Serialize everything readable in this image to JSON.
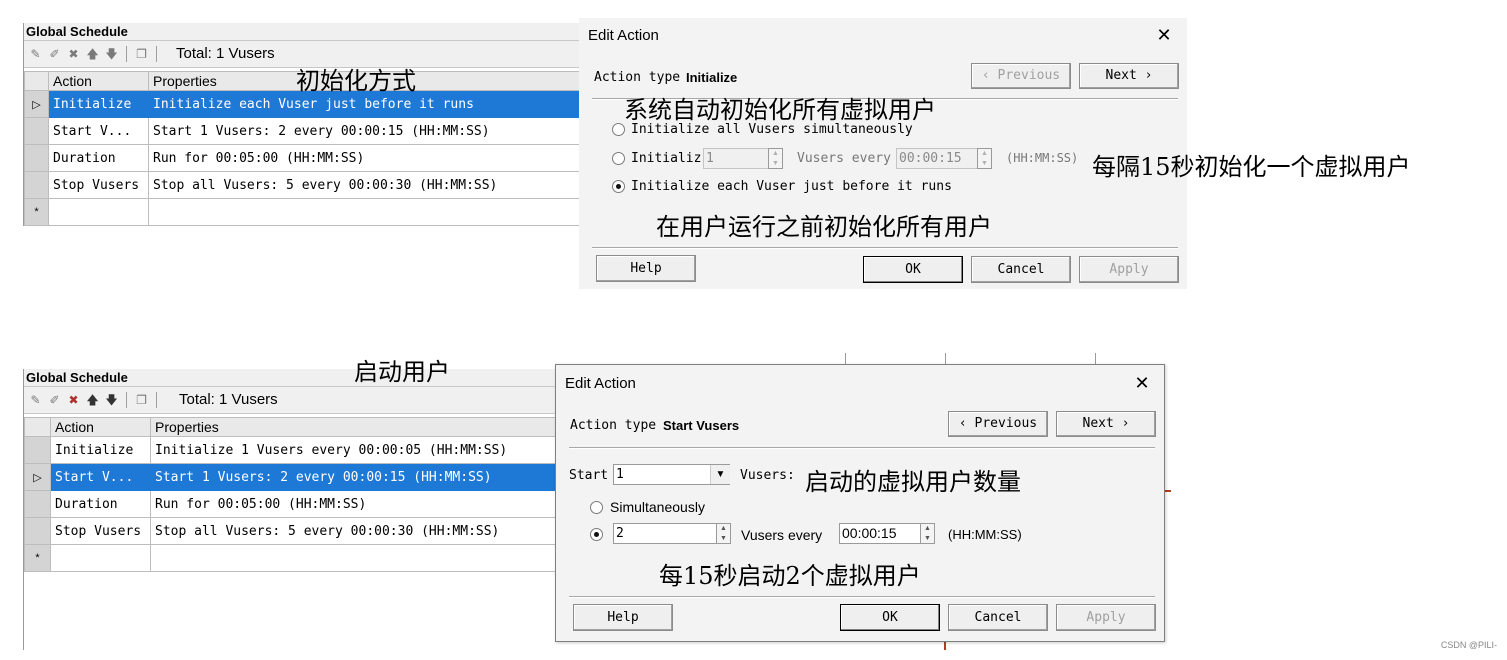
{
  "top": {
    "schedule": {
      "title": "Global Schedule",
      "total": "Total: 1 Vusers",
      "headers": [
        "Action",
        "Properties"
      ],
      "rows": [
        {
          "action": "Initialize",
          "properties": "Initialize each Vuser just before it runs"
        },
        {
          "action": "Start  V...",
          "properties": "Start 1 Vusers: 2 every 00:00:15 (HH:MM:SS)"
        },
        {
          "action": "Duration",
          "properties": "Run for 00:05:00 (HH:MM:SS)"
        },
        {
          "action": "Stop Vusers",
          "properties": "Stop all Vusers: 5 every 00:00:30 (HH:MM:SS)"
        }
      ]
    },
    "dialog": {
      "title": "Edit Action",
      "close": "✕",
      "action_type_label": "Action type",
      "action_type_value": "Initialize",
      "previous": "‹  Previous",
      "next": "Next  ›",
      "opt1": "Initialize all Vusers simultaneously",
      "opt2_label": "Initializ",
      "opt2_count": "1",
      "opt2_mid": "Vusers every",
      "opt2_time": "00:00:15",
      "opt2_unit": "(HH:MM:SS)",
      "opt3": "Initialize each Vuser just before it runs",
      "help": "Help",
      "ok": "OK",
      "cancel": "Cancel",
      "apply": "Apply"
    },
    "notes": {
      "init_method": "初始化方式",
      "auto_init": "系统自动初始化所有虚拟用户",
      "every15": "每隔15秒初始化一个虚拟用户",
      "before_run": "在用户运行之前初始化所有用户"
    }
  },
  "bottom": {
    "schedule": {
      "title": "Global Schedule",
      "total": "Total: 1 Vusers",
      "headers": [
        "Action",
        "Properties"
      ],
      "rows": [
        {
          "action": "Initialize",
          "properties": "Initialize 1 Vusers every 00:00:05 (HH:MM:SS)"
        },
        {
          "action": "Start  V...",
          "properties": "Start 1 Vusers: 2 every 00:00:15 (HH:MM:SS)"
        },
        {
          "action": "Duration",
          "properties": "Run for 00:05:00 (HH:MM:SS)"
        },
        {
          "action": "Stop Vusers",
          "properties": "Stop all Vusers: 5 every 00:00:30 (HH:MM:SS)"
        }
      ]
    },
    "dialog": {
      "title": "Edit Action",
      "close": "✕",
      "action_type_label": "Action type",
      "action_type_value": "Start Vusers",
      "previous": "‹  Previous",
      "next": "Next  ›",
      "start_label": "Start",
      "start_value": "1",
      "vusers_label": "Vusers:",
      "opt1": "Simultaneously",
      "opt2_count": "2",
      "opt2_mid": "Vusers every",
      "opt2_time": "00:00:15",
      "opt2_unit": "(HH:MM:SS)",
      "help": "Help",
      "ok": "OK",
      "cancel": "Cancel",
      "apply": "Apply"
    },
    "notes": {
      "start_users": "启动用户",
      "num_users": "启动的虚拟用户数量",
      "every15": "每15秒启动2个虚拟用户"
    }
  },
  "watermark": "CSDN @PILI-"
}
